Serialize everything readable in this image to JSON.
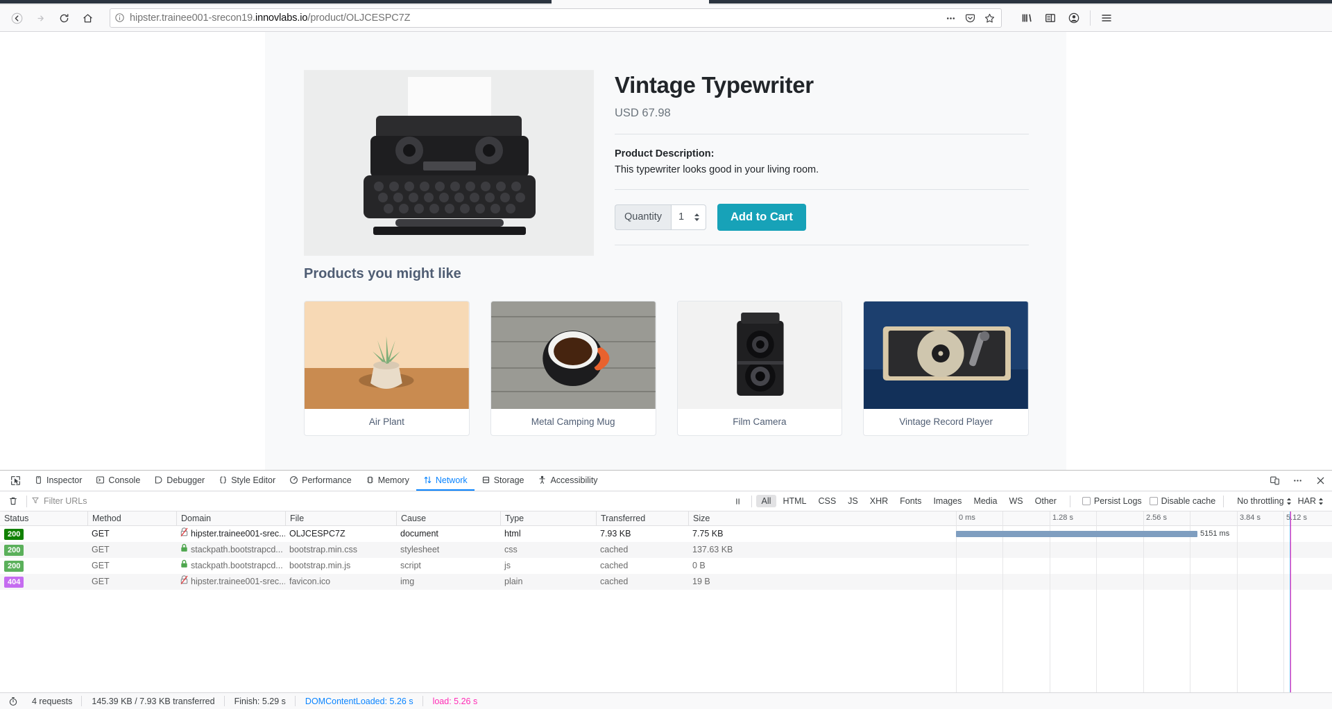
{
  "browser": {
    "nav": {
      "back_label": "Back",
      "forward_label": "Forward",
      "reload_label": "Reload",
      "home_label": "Home"
    },
    "url": {
      "prefix": "hipster.trainee001-srecon19.",
      "domain": "innovlabs.io",
      "path": "/product/OLJCESPC7Z",
      "full": "hipster.trainee001-srecon19.innovlabs.io/product/OLJCESPC7Z",
      "identity_icon": "info-icon",
      "page_actions_icon": "ellipsis-icon",
      "pocket_icon": "pocket-icon",
      "bookmark_icon": "star-icon"
    },
    "toolbar_right": [
      {
        "icon": "library-icon",
        "label": "Library"
      },
      {
        "icon": "sidebar-icon",
        "label": "Sidebars"
      },
      {
        "icon": "account-icon",
        "label": "Account"
      },
      {
        "icon": "menu-icon",
        "label": "Open menu"
      }
    ]
  },
  "page": {
    "product": {
      "title": "Vintage Typewriter",
      "price": "USD 67.98",
      "description_label": "Product Description:",
      "description": "This typewriter looks good in your living room.",
      "quantity_label": "Quantity",
      "quantity_value": "1",
      "add_to_cart_label": "Add to Cart",
      "image_alt": "vintage typewriter on white background"
    },
    "recommendations": {
      "heading": "Products you might like",
      "items": [
        {
          "name": "Air Plant"
        },
        {
          "name": "Metal Camping Mug"
        },
        {
          "name": "Film Camera"
        },
        {
          "name": "Vintage Record Player"
        }
      ]
    }
  },
  "devtools": {
    "tabs": [
      {
        "label": "Inspector",
        "icon": "inspector-icon",
        "active": false
      },
      {
        "label": "Console",
        "icon": "console-icon",
        "active": false
      },
      {
        "label": "Debugger",
        "icon": "debugger-icon",
        "active": false
      },
      {
        "label": "Style Editor",
        "icon": "style-editor-icon",
        "active": false
      },
      {
        "label": "Performance",
        "icon": "performance-icon",
        "active": false
      },
      {
        "label": "Memory",
        "icon": "memory-icon",
        "active": false
      },
      {
        "label": "Network",
        "icon": "network-icon",
        "active": true
      },
      {
        "label": "Storage",
        "icon": "storage-icon",
        "active": false
      },
      {
        "label": "Accessibility",
        "icon": "accessibility-icon",
        "active": false
      }
    ],
    "picker_icon": "element-picker-icon",
    "panel_buttons": [
      {
        "icon": "responsive-design-icon",
        "label": "Responsive Design Mode"
      },
      {
        "icon": "ellipsis-icon",
        "label": "Customize Developer Tools"
      },
      {
        "icon": "close-icon",
        "label": "Close Developer Tools"
      }
    ],
    "toolbar": {
      "clear_icon": "trash-icon",
      "filter_icon": "funnel-icon",
      "filter_placeholder": "Filter URLs",
      "filter_value": "",
      "pause_icon": "pause-icon",
      "type_filters": [
        {
          "label": "All",
          "active": true
        },
        {
          "label": "HTML",
          "active": false
        },
        {
          "label": "CSS",
          "active": false
        },
        {
          "label": "JS",
          "active": false
        },
        {
          "label": "XHR",
          "active": false
        },
        {
          "label": "Fonts",
          "active": false
        },
        {
          "label": "Images",
          "active": false
        },
        {
          "label": "Media",
          "active": false
        },
        {
          "label": "WS",
          "active": false
        },
        {
          "label": "Other",
          "active": false
        }
      ],
      "persist_logs_label": "Persist Logs",
      "persist_logs_checked": false,
      "disable_cache_label": "Disable cache",
      "disable_cache_checked": false,
      "throttling_label": "No throttling",
      "har_label": "HAR"
    },
    "network": {
      "columns": [
        "Status",
        "Method",
        "Domain",
        "File",
        "Cause",
        "Type",
        "Transferred",
        "Size"
      ],
      "rows": [
        {
          "status": "200",
          "status_color": "#108000",
          "method": "GET",
          "domain": "hipster.trainee001-srec...",
          "domain_icon": "insecure-icon",
          "file": "OLJCESPC7Z",
          "cause": "document",
          "type": "html",
          "transferred": "7.93 KB",
          "size": "7.75 KB",
          "bar_start_pct": 0,
          "bar_width_pct": 88.6,
          "bar_label": "5151 ms"
        },
        {
          "status": "200",
          "status_color": "#5bb05b",
          "method": "GET",
          "domain": "stackpath.bootstrapcd...",
          "domain_icon": "lock-icon",
          "file": "bootstrap.min.css",
          "cause": "stylesheet",
          "type": "css",
          "transferred": "cached",
          "size": "137.63 KB",
          "bar_start_pct": 0,
          "bar_width_pct": 0,
          "bar_label": ""
        },
        {
          "status": "200",
          "status_color": "#5bb05b",
          "method": "GET",
          "domain": "stackpath.bootstrapcd...",
          "domain_icon": "lock-icon",
          "file": "bootstrap.min.js",
          "cause": "script",
          "type": "js",
          "transferred": "cached",
          "size": "0 B",
          "bar_start_pct": 0,
          "bar_width_pct": 0,
          "bar_label": ""
        },
        {
          "status": "404",
          "status_color": "#c56cf0",
          "method": "GET",
          "domain": "hipster.trainee001-srec...",
          "domain_icon": "insecure-icon",
          "file": "favicon.ico",
          "cause": "img",
          "type": "plain",
          "transferred": "cached",
          "size": "19 B",
          "bar_start_pct": 0,
          "bar_width_pct": 0,
          "bar_label": ""
        }
      ],
      "timeline_ticks": [
        "0 ms",
        "1.28 s",
        "2.56 s",
        "3.84 s",
        "5.12 s"
      ],
      "load_marker_color": "#ff2bb5",
      "load_marker_pct": 89.0
    },
    "status_bar": {
      "timer_icon": "stopwatch-icon",
      "requests": "4 requests",
      "transferred": "145.39 KB / 7.93 KB transferred",
      "finish": "Finish: 5.29 s",
      "dom_content_loaded": "DOMContentLoaded: 5.26 s",
      "dom_content_loaded_color": "#0a84ff",
      "load": "load: 5.26 s",
      "load_color": "#ff2bb5"
    }
  }
}
